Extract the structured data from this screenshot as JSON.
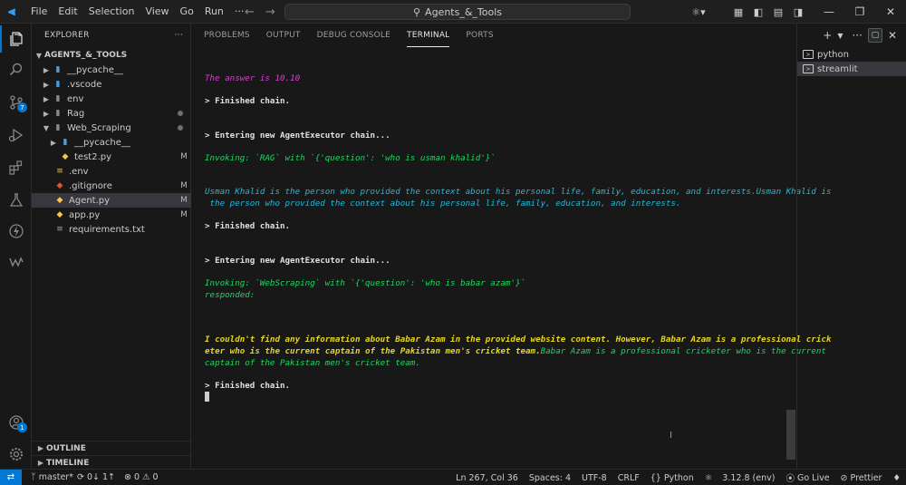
{
  "titlebar": {
    "menu": [
      "File",
      "Edit",
      "Selection",
      "View",
      "Go",
      "Run",
      "···"
    ],
    "search_text": "Agents_&_Tools"
  },
  "sidebar": {
    "title": "EXPLORER",
    "root": "AGENTS_&_TOOLS",
    "items": [
      {
        "label": "__pycache__",
        "status": ""
      },
      {
        "label": ".vscode",
        "status": ""
      },
      {
        "label": "env",
        "status": ""
      },
      {
        "label": "Rag",
        "status": "dot"
      },
      {
        "label": "Web_Scraping",
        "status": "dot"
      },
      {
        "label": "__pycache__",
        "status": ""
      },
      {
        "label": "test2.py",
        "status": "M"
      },
      {
        "label": ".env",
        "status": ""
      },
      {
        "label": ".gitignore",
        "status": "M"
      },
      {
        "label": "Agent.py",
        "status": "M"
      },
      {
        "label": "app.py",
        "status": "M"
      },
      {
        "label": "requirements.txt",
        "status": ""
      }
    ],
    "outline": "OUTLINE",
    "timeline": "TIMELINE"
  },
  "activity": {
    "source_control_badge": "7",
    "accounts_badge": "1"
  },
  "panel": {
    "tabs": [
      "PROBLEMS",
      "OUTPUT",
      "DEBUG CONSOLE",
      "TERMINAL",
      "PORTS"
    ],
    "active_tab": "TERMINAL",
    "terminals": [
      "python",
      "streamlit"
    ]
  },
  "terminal": {
    "lines": [
      {
        "text": "The answer is 10.10",
        "style": "magenta"
      },
      {
        "text": "> Finished chain.",
        "style": "white"
      },
      {
        "text": "> Entering new AgentExecutor chain...",
        "style": "white"
      },
      {
        "text": "Invoking: `RAG` with `{'question': 'who is usman khalid'}`",
        "style": "green"
      },
      {
        "text": "Usman Khalid is the person who provided the context about his personal life, family, education, and interests.Usman Khalid is",
        "style": "cyan"
      },
      {
        "text": " the person who provided the context about his personal life, family, education, and interests.",
        "style": "cyan"
      },
      {
        "text": "> Finished chain.",
        "style": "white"
      },
      {
        "text": "> Entering new AgentExecutor chain...",
        "style": "white"
      },
      {
        "text": "Invoking: `WebScraping` with `{'question': 'who is babar azam'}`",
        "style": "green"
      },
      {
        "text": "responded:",
        "style": "green"
      },
      {
        "text": "I couldn't find any information about Babar Azam in the provided website content. However, Babar Azam is a professional crick",
        "style": "yellow"
      },
      {
        "text": "eter who is the current captain of the Pakistan men's cricket team.",
        "style": "yellow",
        "tail": "Babar Azam is a professional cricketer who is the current"
      },
      {
        "text": "captain of the Pakistan men's cricket team.",
        "style": "green"
      },
      {
        "text": "> Finished chain.",
        "style": "white"
      }
    ]
  },
  "statusbar": {
    "branch": "master*",
    "sync": "0↓ 1↑",
    "errors": "0",
    "warnings": "0",
    "position": "Ln 267, Col 36",
    "spaces": "Spaces: 4",
    "encoding": "UTF-8",
    "eol": "CRLF",
    "language": "Python",
    "interpreter": "3.12.8 (env)",
    "golive": "Go Live",
    "prettier": "Prettier"
  }
}
